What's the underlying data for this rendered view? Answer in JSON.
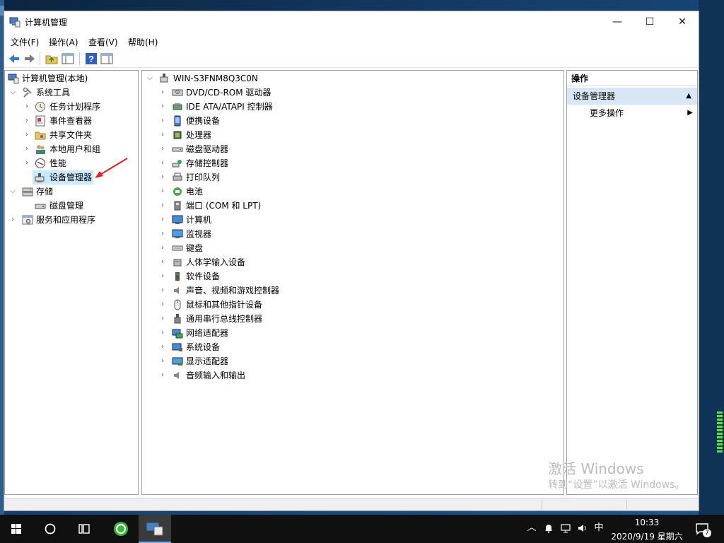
{
  "window": {
    "title": "计算机管理",
    "minimize": "—",
    "maximize": "☐",
    "close": "✕"
  },
  "menu": [
    "文件(F)",
    "操作(A)",
    "查看(V)",
    "帮助(H)"
  ],
  "tree": {
    "root": "计算机管理(本地)",
    "system_tools": "系统工具",
    "task_scheduler": "任务计划程序",
    "event_viewer": "事件查看器",
    "shared_folders": "共享文件夹",
    "local_users": "本地用户和组",
    "performance": "性能",
    "device_manager": "设备管理器",
    "storage": "存储",
    "disk_management": "磁盘管理",
    "services_apps": "服务和应用程序"
  },
  "devices": {
    "computer_name": "WIN-S3FNM8Q3C0N",
    "items": [
      "DVD/CD-ROM 驱动器",
      "IDE ATA/ATAPI 控制器",
      "便携设备",
      "处理器",
      "磁盘驱动器",
      "存储控制器",
      "打印队列",
      "电池",
      "端口 (COM 和 LPT)",
      "计算机",
      "监视器",
      "键盘",
      "人体学输入设备",
      "软件设备",
      "声音、视频和游戏控制器",
      "鼠标和其他指针设备",
      "通用串行总线控制器",
      "网络适配器",
      "系统设备",
      "显示适配器",
      "音频输入和输出"
    ]
  },
  "actions": {
    "header": "操作",
    "section": "设备管理器",
    "more": "更多操作"
  },
  "watermark": {
    "line1": "激活 Windows",
    "line2": "转到“设置”以激活 Windows。"
  },
  "taskbar": {
    "time": "10:33",
    "date": "2020/9/19 星期六",
    "ime": "中",
    "notifications": "7"
  },
  "colors": {
    "selection": "#cce8ff",
    "action_section": "#d9e6f4",
    "annotation": "#e02020"
  }
}
